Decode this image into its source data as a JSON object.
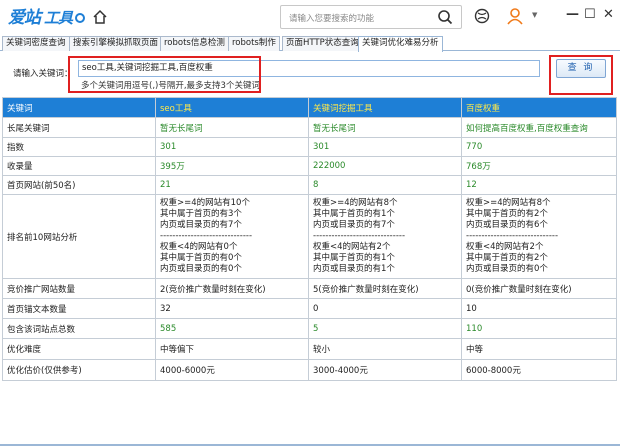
{
  "app": {
    "logo_text": "爱站工具包",
    "search_placeholder": "请输入您要搜索的功能"
  },
  "tabs": [
    {
      "label": "关键词密度查询"
    },
    {
      "label": "搜索引擎模拟抓取页面"
    },
    {
      "label": "robots信息检测"
    },
    {
      "label": "robots制作"
    },
    {
      "label": "页面HTTP状态查询"
    },
    {
      "label": "关键词优化难易分析"
    }
  ],
  "form": {
    "label": "请输入关键词：",
    "value": "seo工具,关键词挖掘工具,百度权重",
    "hint": "多个关键词用逗号(,)号隔开,最多支持3个关键词",
    "query_button": "查 询"
  },
  "table": {
    "rows": [
      {
        "label": "关键词",
        "cells": [
          "seo工具",
          "关键词挖掘工具",
          "百度权重"
        ]
      },
      {
        "label": "长尾关键词",
        "cells": [
          "暂无长尾词",
          "暂无长尾词",
          "如何提高百度权重,百度权重查询"
        ]
      },
      {
        "label": "指数",
        "cells": [
          "301",
          "301",
          "770"
        ]
      },
      {
        "label": "收录量",
        "cells": [
          "395万",
          "222000",
          "768万"
        ]
      },
      {
        "label": "首页网站(前50名)",
        "cells": [
          "21",
          "8",
          "12"
        ]
      },
      {
        "label": "排名前10网站分析",
        "cells": [
          [
            "权重>=4的网站有10个",
            "其中属于首页的有3个",
            "内页或目录页的有7个",
            "------------------------------",
            "权重<4的网站有0个",
            "其中属于首页的有0个",
            "内页或目录页的有0个"
          ],
          [
            "权重>=4的网站有8个",
            "其中属于首页的有1个",
            "内页或目录页的有7个",
            "------------------------------",
            "权重<4的网站有2个",
            "其中属于首页的有1个",
            "内页或目录页的有1个"
          ],
          [
            "权重>=4的网站有8个",
            "其中属于首页的有2个",
            "内页或目录页的有6个",
            "------------------------------",
            "权重<4的网站有2个",
            "其中属于首页的有2个",
            "内页或目录页的有0个"
          ]
        ]
      },
      {
        "label": "竞价推广网站数量",
        "cells": [
          "2(竞价推广数量时刻在变化)",
          "5(竞价推广数量时刻在变化)",
          "0(竞价推广数量时刻在变化)"
        ]
      },
      {
        "label": "首页锚文本数量",
        "cells": [
          "32",
          "0",
          "10"
        ]
      },
      {
        "label": "包含该词站点总数",
        "cells": [
          "585",
          "5",
          "110"
        ]
      },
      {
        "label": "优化难度",
        "cells": [
          "中等偏下",
          "较小",
          "中等"
        ]
      },
      {
        "label": "优化估价(仅供参考)",
        "cells": [
          "4000-6000元",
          "3000-4000元",
          "6000-8000元"
        ]
      }
    ]
  },
  "colors": {
    "accent": "#1e7fd6",
    "highlight": "#e02020",
    "green": "#2a8a2a",
    "keyword_header": "#ffe94a"
  }
}
